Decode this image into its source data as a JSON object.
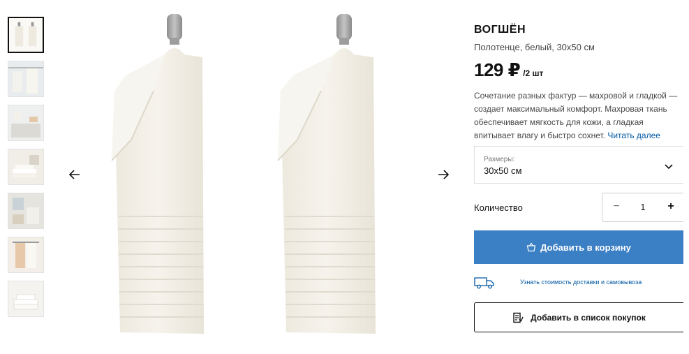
{
  "product": {
    "name": "ВОГШЁН",
    "subtitle": "Полотенце, белый, 30x50 см",
    "price": "129 ₽",
    "price_unit": "/2 шт",
    "description": "Сочетание разных фактур — махровой и гладкой — создает максимальный комфорт. Махровая ткань обеспечивает мягкость для кожи, а гладкая впитывает влагу и быстро сохнет.",
    "read_more": "Читать далее"
  },
  "size": {
    "label": "Размеры:",
    "value": "30x50 см"
  },
  "quantity": {
    "label": "Количество",
    "minus": "−",
    "value": "1",
    "plus": "+"
  },
  "actions": {
    "add_to_cart": "Добавить в корзину",
    "delivery_link": "Узнать стоимость доставки и самовывоза",
    "add_to_list": "Добавить в список покупок"
  },
  "gallery": {
    "thumbnails": [
      "towels-on-hooks",
      "towels-hanging",
      "bathroom-shelf",
      "folded-stack",
      "bathroom-interior",
      "towel-on-rail",
      "folded-towels"
    ],
    "active_index": 0
  },
  "colors": {
    "accent_blue": "#3b7fc4",
    "link_blue": "#0058a3",
    "towel": "#f3f0e8"
  }
}
